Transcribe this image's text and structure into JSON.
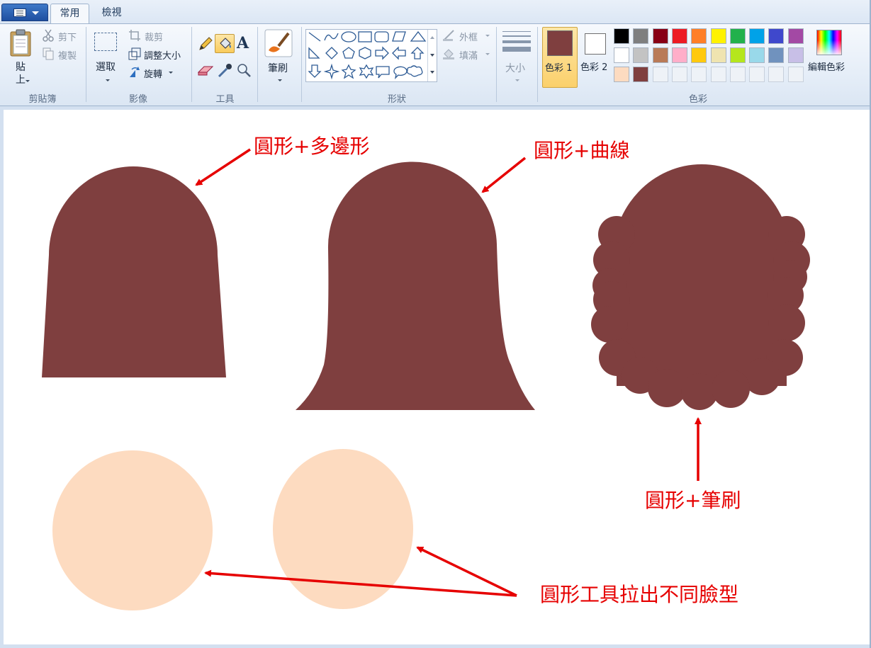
{
  "tabs": [
    {
      "label": "常用",
      "active": true
    },
    {
      "label": "檢視",
      "active": false
    }
  ],
  "clipboard": {
    "paste_label": "貼\n上",
    "cut_label": "剪下",
    "copy_label": "複製",
    "group_label": "剪貼簿"
  },
  "image": {
    "select_label": "選取",
    "crop_label": "裁剪",
    "resize_label": "調整大小",
    "rotate_label": "旋轉",
    "group_label": "影像"
  },
  "tools": {
    "group_label": "工具",
    "items": [
      "pencil-icon",
      "fill-bucket-icon",
      "text-icon",
      "eraser-icon",
      "color-picker-icon",
      "magnifier-icon"
    ]
  },
  "brushes": {
    "label": "筆刷"
  },
  "shapes": {
    "group_label": "形狀",
    "outline_label": "外框",
    "fill_label": "填滿"
  },
  "size": {
    "label": "大小"
  },
  "colors": {
    "group_label": "色彩",
    "color1_label": "色彩 1",
    "color2_label": "色彩 2",
    "edit_label": "編輯色彩",
    "color1": "#7f3f3f",
    "color2": "#ffffff",
    "palette_row1": [
      "#000000",
      "#7f7f7f",
      "#880015",
      "#ed1c24",
      "#ff7f27",
      "#fff200",
      "#22b14c",
      "#00a2e8",
      "#3f48cc",
      "#a349a4"
    ],
    "palette_row2": [
      "#ffffff",
      "#c3c3c3",
      "#b97a57",
      "#ffaec9",
      "#ffc90e",
      "#efe4b0",
      "#b5e61d",
      "#99d9ea",
      "#7092be",
      "#c8bfe7"
    ],
    "palette_row3": [
      "#fddbc0",
      "#7f3f3f"
    ]
  },
  "canvas": {
    "hair_color": "#7f3f3f",
    "skin_color": "#fddbc0",
    "annotations": {
      "a1": "圓形+多邊形",
      "a2": "圓形+曲線",
      "a3": "圓形+筆刷",
      "a4": "圓形工具拉出不同臉型"
    }
  }
}
